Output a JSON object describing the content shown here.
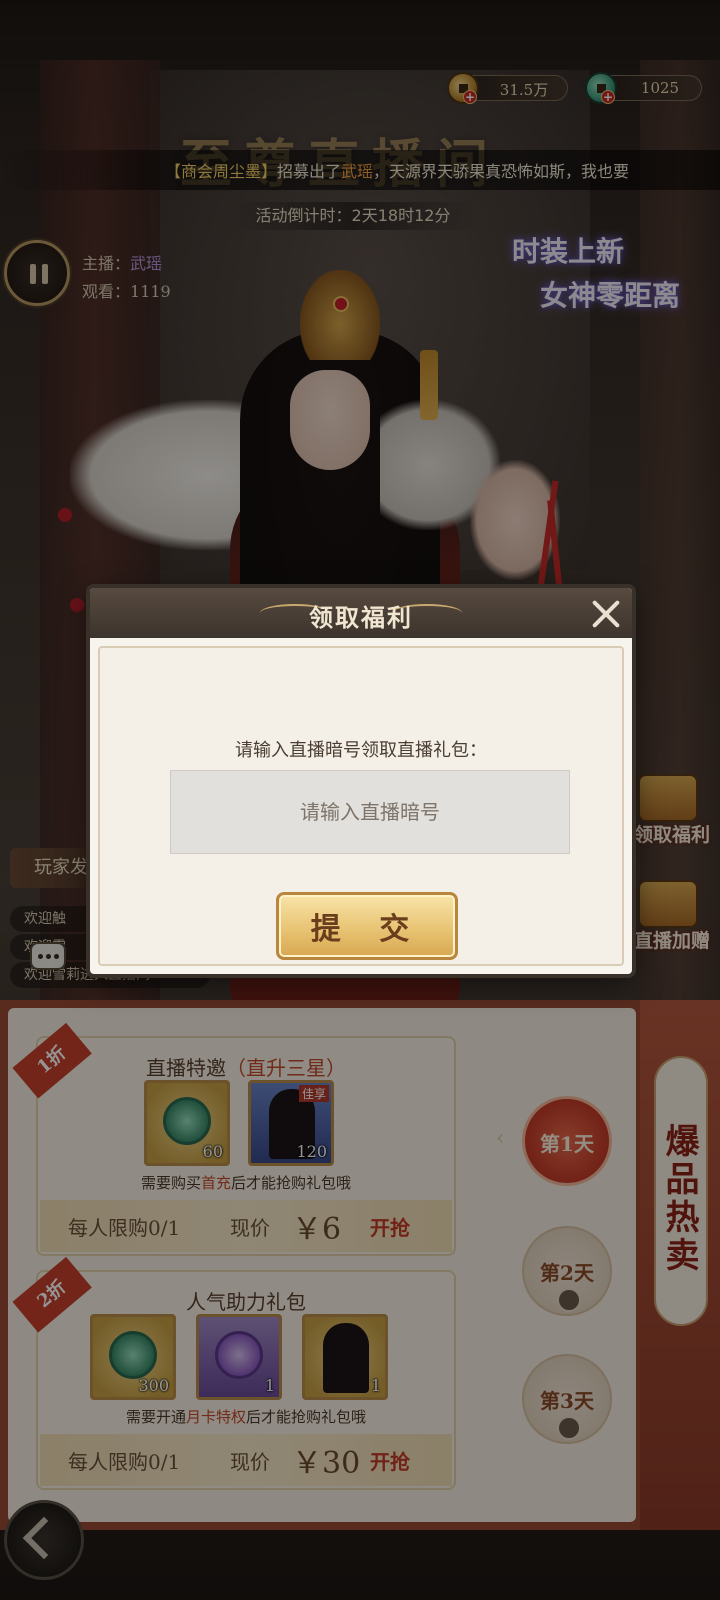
{
  "currency": {
    "gold": "31.5万",
    "jade": "1025",
    "plus": "+"
  },
  "title_bg": "至尊直播间",
  "marquee": {
    "sender": "【商会周尘墨】",
    "text_before": "招募出了",
    "highlight": "武瑶",
    "text_after": "，天源界天骄果真恐怖如斯，我也要"
  },
  "countdown": "活动倒计时：2天18时12分",
  "host": {
    "host_label": "主播：",
    "host_name": "武瑶",
    "viewers_label": "观看：",
    "viewers": "1119"
  },
  "promo": {
    "line1": "时装上新",
    "line2": "女神零距离"
  },
  "side_buttons": {
    "claim": "领取福利",
    "gift": "直播加赠"
  },
  "chat": {
    "tab_label": "玩家发",
    "lines": [
      "欢迎触",
      "欢迎雪",
      "欢迎雪莉进入直播间"
    ]
  },
  "modal": {
    "title": "领取福利",
    "prompt": "请输入直播暗号领取直播礼包：",
    "input_placeholder": "请输入直播暗号",
    "input_value": "",
    "submit": "提 交"
  },
  "store": {
    "hot_banner": "爆品热卖",
    "days": [
      {
        "label": "第1天",
        "locked": false
      },
      {
        "label": "第2天",
        "locked": true
      },
      {
        "label": "第3天",
        "locked": true
      }
    ],
    "offers": [
      {
        "discount": "1折",
        "title": "直播特邀",
        "title_highlight": "（直升三星）",
        "items": [
          {
            "count": "60",
            "kind": "jade-coin"
          },
          {
            "count": "120",
            "kind": "hero-card",
            "tag": "佳享"
          }
        ],
        "note_before": "需要购买",
        "note_highlight": "首充",
        "note_after": "后才能抢购礼包哦",
        "limit": "每人限购0/1",
        "price_label": "现价",
        "price": "￥6",
        "buy": "开抢"
      },
      {
        "discount": "2折",
        "title": "人气助力礼包",
        "title_highlight": "",
        "items": [
          {
            "count": "300",
            "kind": "jade-coin"
          },
          {
            "count": "1",
            "kind": "purple-pouch"
          },
          {
            "count": "1",
            "kind": "hero-card"
          }
        ],
        "note_before": "需要开通",
        "note_highlight": "月卡特权",
        "note_after": "后才能抢购礼包哦",
        "limit": "每人限购0/1",
        "price_label": "现价",
        "price": "￥30",
        "buy": "开抢"
      }
    ]
  },
  "colors": {
    "accent_red": "#c43a28",
    "gold": "#d8a850",
    "modal_header": "#4a3e35"
  }
}
